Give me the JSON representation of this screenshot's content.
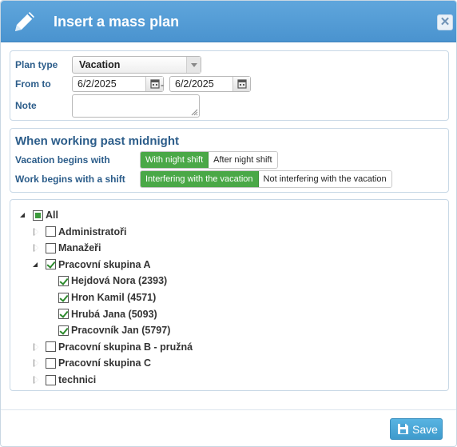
{
  "dialog": {
    "title": "Insert a mass plan",
    "close_glyph": "✕",
    "title_icon": "pencil-icon"
  },
  "form": {
    "plan_type_label": "Plan type",
    "plan_type_value": "Vacation",
    "from_to_label": "From to",
    "date_from": "6/2/2025",
    "date_to": "6/2/2025",
    "dash": "-",
    "note_label": "Note",
    "note_value": ""
  },
  "midnight": {
    "title": "When working past midnight",
    "vacation_label": "Vacation begins with",
    "vacation_options": [
      "With night shift",
      "After night shift"
    ],
    "vacation_selected": 0,
    "work_label": "Work begins with a shift",
    "work_options": [
      "Interfering with the vacation",
      "Not interfering with the vacation"
    ],
    "work_selected": 0
  },
  "tree": {
    "nodes": [
      {
        "label": "All",
        "state": "partial",
        "toggle": "expanded",
        "level": 0
      },
      {
        "label": "Administratoři",
        "state": "unchecked",
        "toggle": "collapsed",
        "level": 1
      },
      {
        "label": "Manažeři",
        "state": "unchecked",
        "toggle": "collapsed",
        "level": 1
      },
      {
        "label": "Pracovní skupina A",
        "state": "checked",
        "toggle": "expanded",
        "level": 1
      },
      {
        "label": "Hejdová Nora (2393)",
        "state": "checked",
        "toggle": "none",
        "level": 2
      },
      {
        "label": "Hron Kamil (4571)",
        "state": "checked",
        "toggle": "none",
        "level": 2
      },
      {
        "label": "Hrubá Jana (5093)",
        "state": "checked",
        "toggle": "none",
        "level": 2
      },
      {
        "label": "Pracovník Jan (5797)",
        "state": "checked",
        "toggle": "none",
        "level": 2
      },
      {
        "label": "Pracovní skupina B - pružná",
        "state": "unchecked",
        "toggle": "collapsed",
        "level": 1
      },
      {
        "label": "Pracovní skupina C",
        "state": "unchecked",
        "toggle": "collapsed",
        "level": 1
      },
      {
        "label": "technici",
        "state": "unchecked",
        "toggle": "collapsed",
        "level": 1
      }
    ]
  },
  "footer": {
    "save_label": "Save"
  },
  "colors": {
    "title_bar": "#4a93cf",
    "accent_green": "#4aa847",
    "label_blue": "#2c5d8a",
    "save_blue": "#3f9bcc"
  }
}
